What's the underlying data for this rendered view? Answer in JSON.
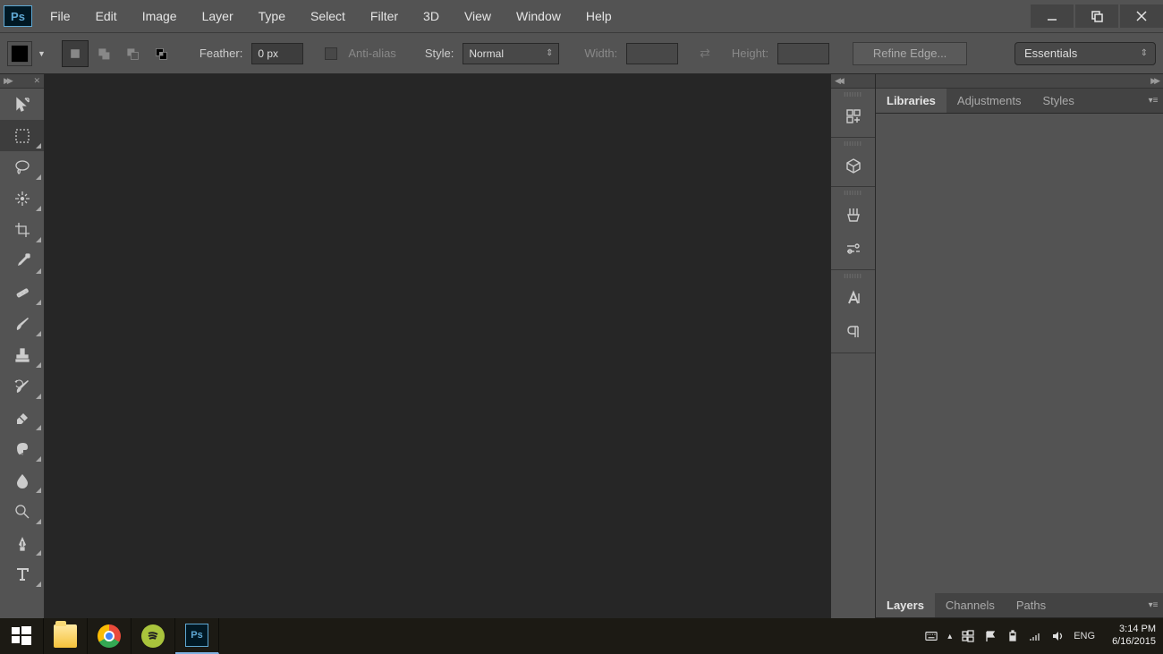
{
  "menu": {
    "items": [
      "File",
      "Edit",
      "Image",
      "Layer",
      "Type",
      "Select",
      "Filter",
      "3D",
      "View",
      "Window",
      "Help"
    ]
  },
  "options": {
    "feather_label": "Feather:",
    "feather_value": "0 px",
    "antialias_label": "Anti-alias",
    "style_label": "Style:",
    "style_value": "Normal",
    "width_label": "Width:",
    "height_label": "Height:",
    "refine_label": "Refine Edge..."
  },
  "workspace": {
    "value": "Essentials"
  },
  "panels": {
    "top": {
      "tabs": [
        "Libraries",
        "Adjustments",
        "Styles"
      ],
      "active": 0
    },
    "bottom": {
      "tabs": [
        "Layers",
        "Channels",
        "Paths"
      ],
      "active": 0
    }
  },
  "systray": {
    "lang": "ENG",
    "time": "3:14 PM",
    "date": "6/16/2015"
  }
}
